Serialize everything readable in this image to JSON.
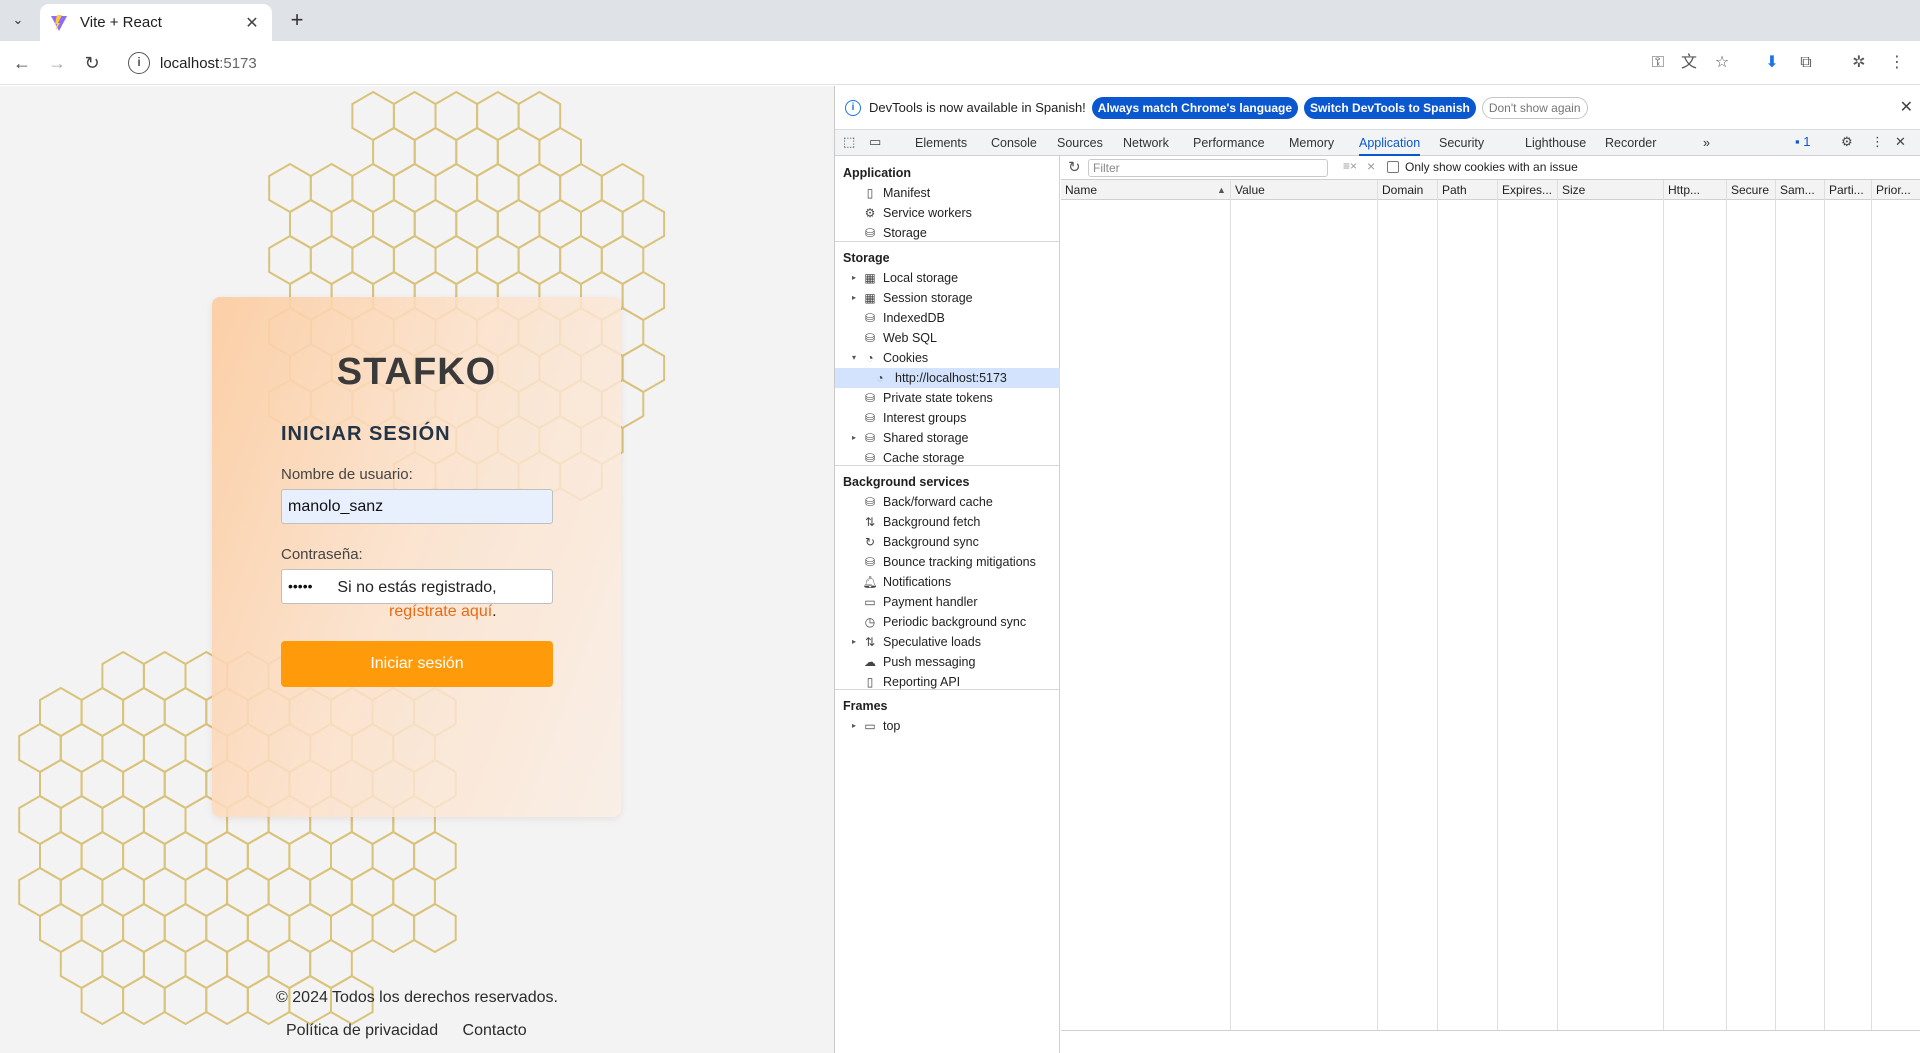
{
  "browser": {
    "tab_title": "Vite + React",
    "tab_close": "✕",
    "new_tab": "+",
    "url_host": "localhost",
    "url_port": ":5173"
  },
  "page": {
    "brand": "STAFKO",
    "login_title": "INICIAR SESIÓN",
    "username_label": "Nombre de usuario:",
    "username_value": "manolo_sanz",
    "password_label": "Contraseña:",
    "password_value": "•••••",
    "login_button": "Iniciar sesión",
    "register_prefix": "Si no estás registrado,",
    "register_link": "regístrate aquí",
    "register_suffix": ".",
    "copyright": "© 2024 Todos los derechos reservados.",
    "privacy_link": "Política de privacidad",
    "contact_link": "Contacto"
  },
  "devtools": {
    "infobar": {
      "message": "DevTools is now available in Spanish!",
      "match_button": "Always match Chrome's language",
      "switch_button": "Switch DevTools to Spanish",
      "dismiss_button": "Don't show again"
    },
    "tabs": [
      "Elements",
      "Console",
      "Sources",
      "Network",
      "Performance",
      "Memory",
      "Application",
      "Security",
      "Lighthouse",
      "Recorder"
    ],
    "selected_tab": "Application",
    "more_tabs": "»",
    "issues_count": "1",
    "sidebar": {
      "application_header": "Application",
      "application_items": [
        "Manifest",
        "Service workers",
        "Storage"
      ],
      "storage_header": "Storage",
      "storage_items": [
        "Local storage",
        "Session storage",
        "IndexedDB",
        "Web SQL",
        "Cookies"
      ],
      "cookie_origin": "http://localhost:5173",
      "storage_items_2": [
        "Private state tokens",
        "Interest groups",
        "Shared storage",
        "Cache storage"
      ],
      "background_header": "Background services",
      "background_items": [
        "Back/forward cache",
        "Background fetch",
        "Background sync",
        "Bounce tracking mitigations",
        "Notifications",
        "Payment handler",
        "Periodic background sync",
        "Speculative loads",
        "Push messaging",
        "Reporting API"
      ],
      "frames_header": "Frames",
      "frames_items": [
        "top"
      ]
    },
    "filter_placeholder": "Filter",
    "only_issues_label": "Only show cookies with an issue",
    "columns": [
      "Name",
      "Value",
      "Domain",
      "Path",
      "Expires...",
      "Size",
      "Http...",
      "Secure",
      "Sam...",
      "Parti...",
      "Prior..."
    ]
  },
  "colors": {
    "accent_orange": "#ff9a0b",
    "devtools_blue": "#0b57d0",
    "link_orange": "#e86b14"
  }
}
